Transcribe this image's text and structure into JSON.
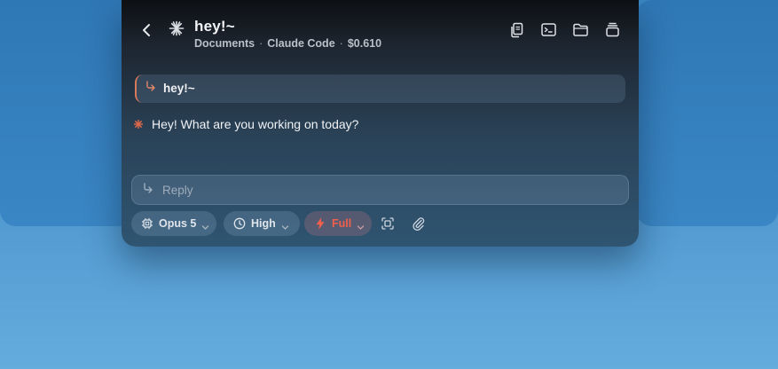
{
  "header": {
    "title": "hey!~",
    "subtitle": {
      "folder": "Documents",
      "app": "Claude Code",
      "cost": "$0.610"
    },
    "icons": [
      "back-chevron-icon",
      "spark-icon",
      "copy-icon",
      "terminal-icon",
      "folder-icon",
      "stack-icon"
    ]
  },
  "conversation": {
    "user_message": "hey!~",
    "assistant_message": "Hey! What are you working on today?"
  },
  "reply": {
    "placeholder": "Reply"
  },
  "toolbar": {
    "model": "Opus 5",
    "effort": "High",
    "mode": "Full",
    "icons": [
      "cpu-icon",
      "clock-icon",
      "bolt-icon",
      "screenshot-icon",
      "paperclip-icon"
    ]
  },
  "colors": {
    "accent": "#d8795a",
    "mode_red": "#f0604c",
    "desktop_blue": "#4a93cc"
  }
}
